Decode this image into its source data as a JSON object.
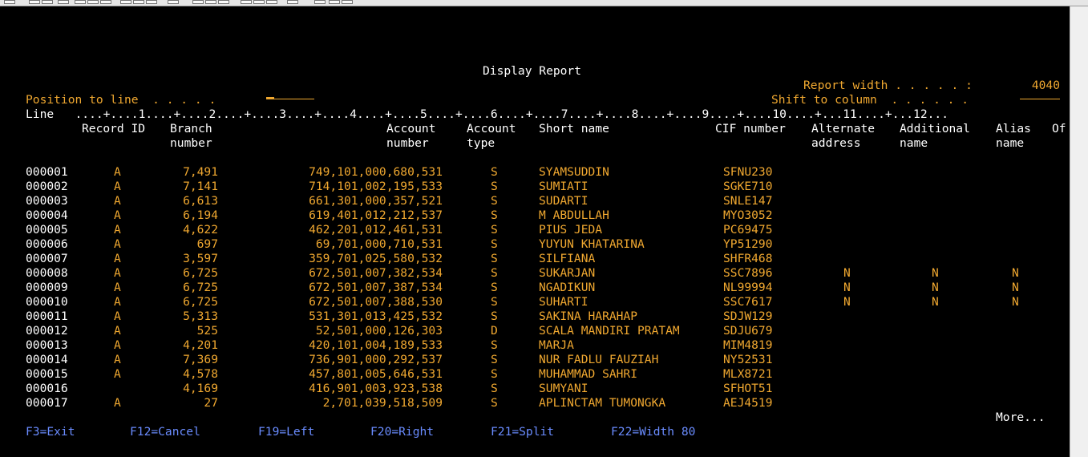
{
  "header": {
    "title": "Display Report",
    "report_width_label": "Report width . . . . . :",
    "report_width_value": "4040",
    "position_label": "Position to line  . . . . .",
    "position_value": "",
    "shift_label": "Shift to column  . . . . . .",
    "shift_value": "",
    "ruler": "Line   ....+....1....+....2....+....3....+....4....+....5....+....6....+....7....+....8....+....9....+....10....+...11....+...12..."
  },
  "columns": {
    "record_id": "Record ID",
    "branch_1": "Branch",
    "branch_2": "number",
    "account_1": "Account",
    "account_2": "number",
    "acctype_1": "Account",
    "acctype_2": "type",
    "short_name": "Short name",
    "cif": "CIF number",
    "alt_1": "Alternate",
    "alt_2": "address",
    "addl_1": "Additional",
    "addl_2": "name",
    "alias_1": "Alias",
    "alias_2": "name",
    "of": "Of"
  },
  "rows": [
    {
      "line": "000001",
      "rec": "A",
      "branch": "7,491",
      "account": "749,101,000,680,531",
      "type": "S",
      "name": "SYAMSUDDIN",
      "cif": "SFNU230",
      "alt": "",
      "addl": "",
      "alias": ""
    },
    {
      "line": "000002",
      "rec": "A",
      "branch": "7,141",
      "account": "714,101,002,195,533",
      "type": "S",
      "name": "SUMIATI",
      "cif": "SGKE710",
      "alt": "",
      "addl": "",
      "alias": ""
    },
    {
      "line": "000003",
      "rec": "A",
      "branch": "6,613",
      "account": "661,301,000,357,521",
      "type": "S",
      "name": "SUDARTI",
      "cif": "SNLE147",
      "alt": "",
      "addl": "",
      "alias": ""
    },
    {
      "line": "000004",
      "rec": "A",
      "branch": "6,194",
      "account": "619,401,012,212,537",
      "type": "S",
      "name": "M ABDULLAH",
      "cif": "MYO3052",
      "alt": "",
      "addl": "",
      "alias": ""
    },
    {
      "line": "000005",
      "rec": "A",
      "branch": "4,622",
      "account": "462,201,012,461,531",
      "type": "S",
      "name": "PIUS JEDA",
      "cif": "PC69475",
      "alt": "",
      "addl": "",
      "alias": ""
    },
    {
      "line": "000006",
      "rec": "A",
      "branch": "697",
      "account": "69,701,000,710,531",
      "type": "S",
      "name": "YUYUN KHATARINA",
      "cif": "YP51290",
      "alt": "",
      "addl": "",
      "alias": ""
    },
    {
      "line": "000007",
      "rec": "A",
      "branch": "3,597",
      "account": "359,701,025,580,532",
      "type": "S",
      "name": "SILFIANA",
      "cif": "SHFR468",
      "alt": "",
      "addl": "",
      "alias": ""
    },
    {
      "line": "000008",
      "rec": "A",
      "branch": "6,725",
      "account": "672,501,007,382,534",
      "type": "S",
      "name": "SUKARJAN",
      "cif": "SSC7896",
      "alt": "N",
      "addl": "N",
      "alias": "N"
    },
    {
      "line": "000009",
      "rec": "A",
      "branch": "6,725",
      "account": "672,501,007,387,534",
      "type": "S",
      "name": "NGADIKUN",
      "cif": "NL99994",
      "alt": "N",
      "addl": "N",
      "alias": "N"
    },
    {
      "line": "000010",
      "rec": "A",
      "branch": "6,725",
      "account": "672,501,007,388,530",
      "type": "S",
      "name": "SUHARTI",
      "cif": "SSC7617",
      "alt": "N",
      "addl": "N",
      "alias": "N"
    },
    {
      "line": "000011",
      "rec": "A",
      "branch": "5,313",
      "account": "531,301,013,425,532",
      "type": "S",
      "name": "SAKINA HARAHAP",
      "cif": "SDJW129",
      "alt": "",
      "addl": "",
      "alias": ""
    },
    {
      "line": "000012",
      "rec": "A",
      "branch": "525",
      "account": "52,501,000,126,303",
      "type": "D",
      "name": "SCALA MANDIRI PRATAM",
      "cif": "SDJU679",
      "alt": "",
      "addl": "",
      "alias": ""
    },
    {
      "line": "000013",
      "rec": "A",
      "branch": "4,201",
      "account": "420,101,004,189,533",
      "type": "S",
      "name": "MARJA",
      "cif": "MIM4819",
      "alt": "",
      "addl": "",
      "alias": ""
    },
    {
      "line": "000014",
      "rec": "A",
      "branch": "7,369",
      "account": "736,901,000,292,537",
      "type": "S",
      "name": "NUR FADLU FAUZIAH",
      "cif": "NY52531",
      "alt": "",
      "addl": "",
      "alias": ""
    },
    {
      "line": "000015",
      "rec": "A",
      "branch": "4,578",
      "account": "457,801,005,646,531",
      "type": "S",
      "name": "MUHAMMAD SAHRI",
      "cif": "MLX8721",
      "alt": "",
      "addl": "",
      "alias": ""
    },
    {
      "line": "000016",
      "rec": "",
      "branch": "4,169",
      "account": "416,901,003,923,538",
      "type": "S",
      "name": "SUMYANI",
      "cif": "SFHOT51",
      "alt": "",
      "addl": "",
      "alias": ""
    },
    {
      "line": "000017",
      "rec": "A",
      "branch": "27",
      "account": "2,701,039,518,509",
      "type": "S",
      "name": "APLINCTAM TUMONGKA",
      "cif": "AEJ4519",
      "alt": "",
      "addl": "",
      "alias": ""
    }
  ],
  "more_label": "More...",
  "function_keys": [
    {
      "label": "F3=Exit"
    },
    {
      "label": "F12=Cancel"
    },
    {
      "label": "F19=Left"
    },
    {
      "label": "F20=Right"
    },
    {
      "label": "F21=Split"
    },
    {
      "label": "F22=Width 80"
    }
  ],
  "colors": {
    "background": "#000000",
    "heading": "#ffffff",
    "data": "#f0a830",
    "function_keys": "#6a8cff"
  }
}
